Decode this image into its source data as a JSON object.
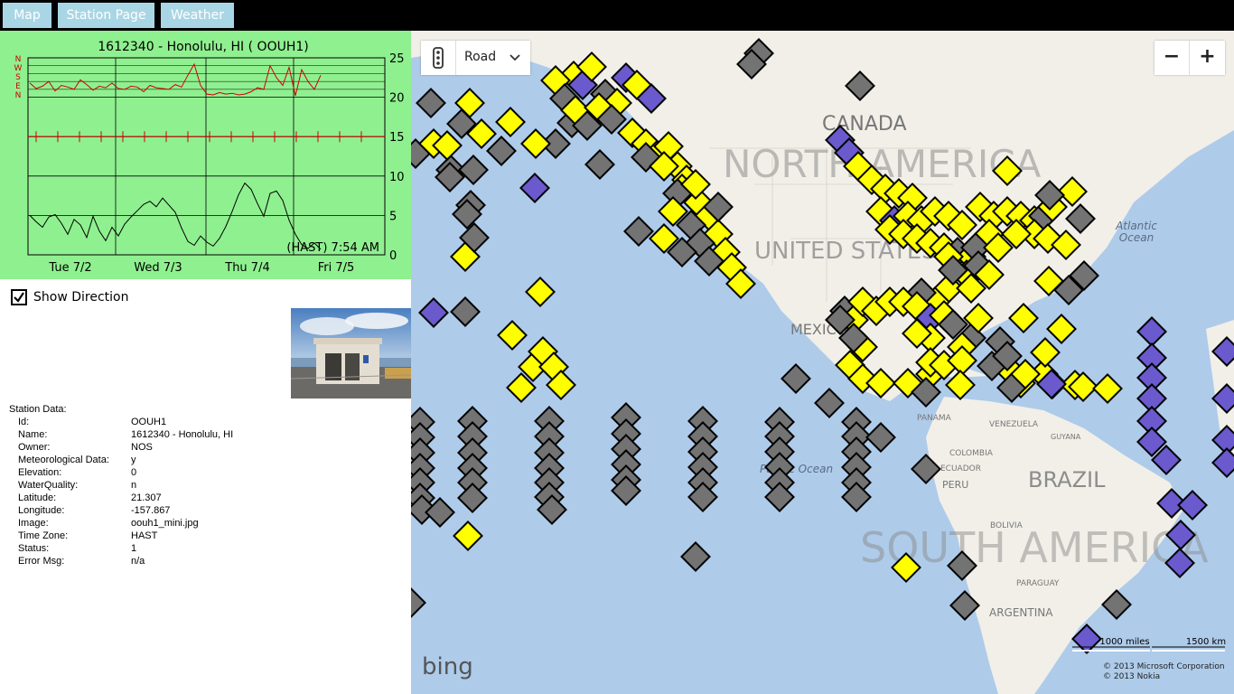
{
  "nav": {
    "map_label": "Map",
    "station_page_label": "Station Page",
    "weather_label": "Weather"
  },
  "chart_data": {
    "type": "line",
    "title": "1612340 - Honolulu, HI ( OOUH1)",
    "x_tick_labels": [
      "Tue  7/2",
      "Wed  7/3",
      "Thu  7/4",
      "Fri  7/5"
    ],
    "y_tick_labels": [
      "25",
      "20",
      "15",
      "10",
      "5",
      "0"
    ],
    "ylim": [
      0,
      25
    ],
    "direction_labels": [
      "N",
      "W",
      "S",
      "E",
      "N"
    ],
    "annotation": "(HAST) 7:54 AM",
    "grid": true,
    "series": [
      {
        "values": [
          5,
          4.2,
          3.5,
          4.8,
          5.1,
          4.0,
          2.6,
          4.5,
          3.8,
          2.2,
          4.9,
          3.0,
          1.8,
          3.5,
          2.4,
          3.9,
          4.8,
          5.6,
          6.4,
          6.8,
          6.1,
          7.2,
          6.3,
          5.4,
          3.4,
          1.7,
          1.2,
          2.4,
          1.6,
          1.1,
          2.1,
          3.6,
          5.5,
          7.6,
          9.1,
          8.3,
          6.5,
          4.9,
          7.8,
          8.1,
          6.9,
          4.4,
          2.6,
          1.3,
          0.8,
          1.5,
          0.7
        ]
      },
      {
        "values": [
          21.8,
          21.1,
          21.4,
          22.0,
          20.8,
          21.5,
          21.3,
          21.0,
          22.2,
          21.6,
          20.9,
          21.4,
          21.2,
          21.8,
          21.1,
          21.0,
          21.4,
          21.3,
          20.7,
          21.5,
          21.2,
          21.1,
          21.0,
          21.6,
          21.3,
          22.8,
          24.2,
          21.5,
          20.4,
          20.3,
          20.6,
          20.4,
          20.5,
          20.3,
          20.4,
          20.7,
          21.2,
          21.0,
          24.0,
          22.5,
          21.5,
          23.8,
          20.2,
          23.5,
          22.0,
          21.0,
          22.8
        ]
      }
    ]
  },
  "show_direction": {
    "label": "Show Direction",
    "checked": true
  },
  "station": {
    "title": "Station Data:",
    "fields": [
      {
        "key": "Id:",
        "value": "OOUH1"
      },
      {
        "key": "Name:",
        "value": "1612340 - Honolulu, HI"
      },
      {
        "key": "Owner:",
        "value": "NOS"
      },
      {
        "key": "Meteorological Data:",
        "value": "y"
      },
      {
        "key": "Elevation:",
        "value": "0"
      },
      {
        "key": "WaterQuality:",
        "value": "n"
      },
      {
        "key": "Latitude:",
        "value": "21.307"
      },
      {
        "key": "Longitude:",
        "value": "-157.867"
      },
      {
        "key": "Image:",
        "value": "oouh1_mini.jpg"
      },
      {
        "key": "Time Zone:",
        "value": "HAST"
      },
      {
        "key": "Status:",
        "value": "1"
      },
      {
        "key": "Error Msg:",
        "value": "n/a"
      }
    ]
  },
  "map": {
    "style_label": "Road",
    "zoom_out_label": "−",
    "zoom_in_label": "+",
    "labels": {
      "canada": "CANADA",
      "north_america": "NORTH AMERICA",
      "united_states": "UNITED STATES",
      "mexico": "MEXICO",
      "atlantic": "Atlantic",
      "ocean": "Ocean",
      "panama": "PANAMA",
      "venezuela": "VENEZUELA",
      "guyana": "GUYANA",
      "colombia": "COLOMBIA",
      "ecuador": "ECUADOR",
      "peru": "PERU",
      "brazil": "BRAZIL",
      "bolivia": "BOLIVIA",
      "paraguay": "PARAGUAY",
      "south_america": "SOUTH AMERICA",
      "argentina": "ARGENTINA",
      "pacific": "Pacific Ocean"
    },
    "bing_label": "bing",
    "scale_miles": "1000 miles",
    "scale_km": "1500 km",
    "copyright_1": "© 2013 Microsoft Corporation",
    "copyright_2": "© 2013 Nokia",
    "colors": {
      "yellow": "#ffff00",
      "gray": "#737373",
      "purple": "#6a5acd",
      "water": "#aecbea",
      "land": "#f1efe8"
    }
  }
}
